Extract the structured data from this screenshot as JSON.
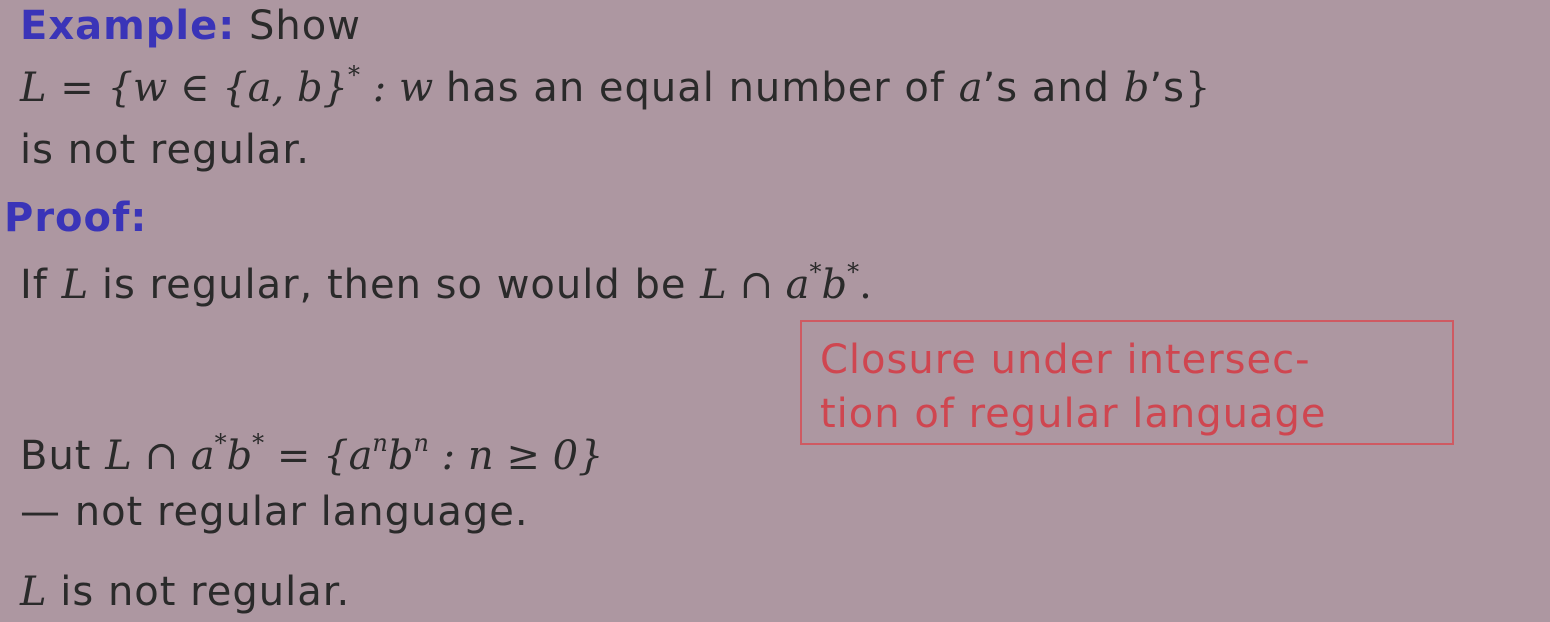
{
  "example": {
    "heading": "Example:",
    "intro": "Show",
    "definition": {
      "lhs": "L",
      "eq": "=",
      "set_open": "{w ∈ {a, b}",
      "star": "*",
      "colon_w": " : w ",
      "text1": "has an equal number of ",
      "a": "a",
      "text2": "’s and ",
      "b": "b",
      "text3": "’s",
      "close": "}"
    },
    "conclusion": "is not regular."
  },
  "proof": {
    "heading": "Proof:",
    "line1": {
      "pre": "If ",
      "L": "L",
      "mid": " is regular, then so would be ",
      "expr_L": "L ∩ a",
      "star1": "*",
      "b": "b",
      "star2": "*",
      "end": "."
    },
    "callout": {
      "line1": "Closure under intersec-",
      "line2": "tion of regular language"
    },
    "line2": {
      "pre": "But ",
      "expr": "L ∩ a",
      "star1": "*",
      "b": "b",
      "star2": "*",
      "eq": " = {a",
      "n1": "n",
      "b2": "b",
      "n2": "n",
      "cond": " : n ≥ 0}"
    },
    "line3": "— not regular language.",
    "final": {
      "L": "L",
      "text": " is not regular."
    }
  },
  "colors": {
    "background": "#ad97a1",
    "heading": "#3a34b8",
    "callout": "#cf4650"
  }
}
